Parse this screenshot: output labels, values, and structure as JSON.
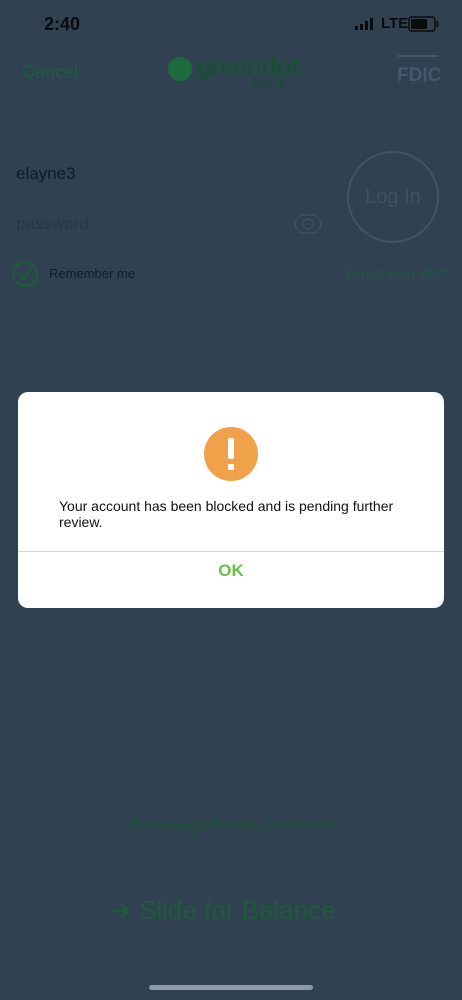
{
  "status_bar": {
    "time": "2:40",
    "network": "LTE"
  },
  "header": {
    "cancel_label": "Cancel",
    "logo_word": "greendot",
    "logo_sub": "bank",
    "fdic_label": "FDIC"
  },
  "login_form": {
    "username_value": "elayne3",
    "password_placeholder": "password",
    "login_button_label": "Log In",
    "remember_label": "Remember me",
    "forgot_label": "Forgot login info?"
  },
  "footer": {
    "privacy_link": "Technology Privacy Statement",
    "slide_label": "Slide for Balance"
  },
  "alert": {
    "icon": "warning-icon",
    "message": "Your account has been blocked and is pending further review.",
    "ok_label": "OK"
  },
  "colors": {
    "overlay": "#304252",
    "brand_green": "#6abf4b",
    "warning_orange": "#f0a24a"
  }
}
